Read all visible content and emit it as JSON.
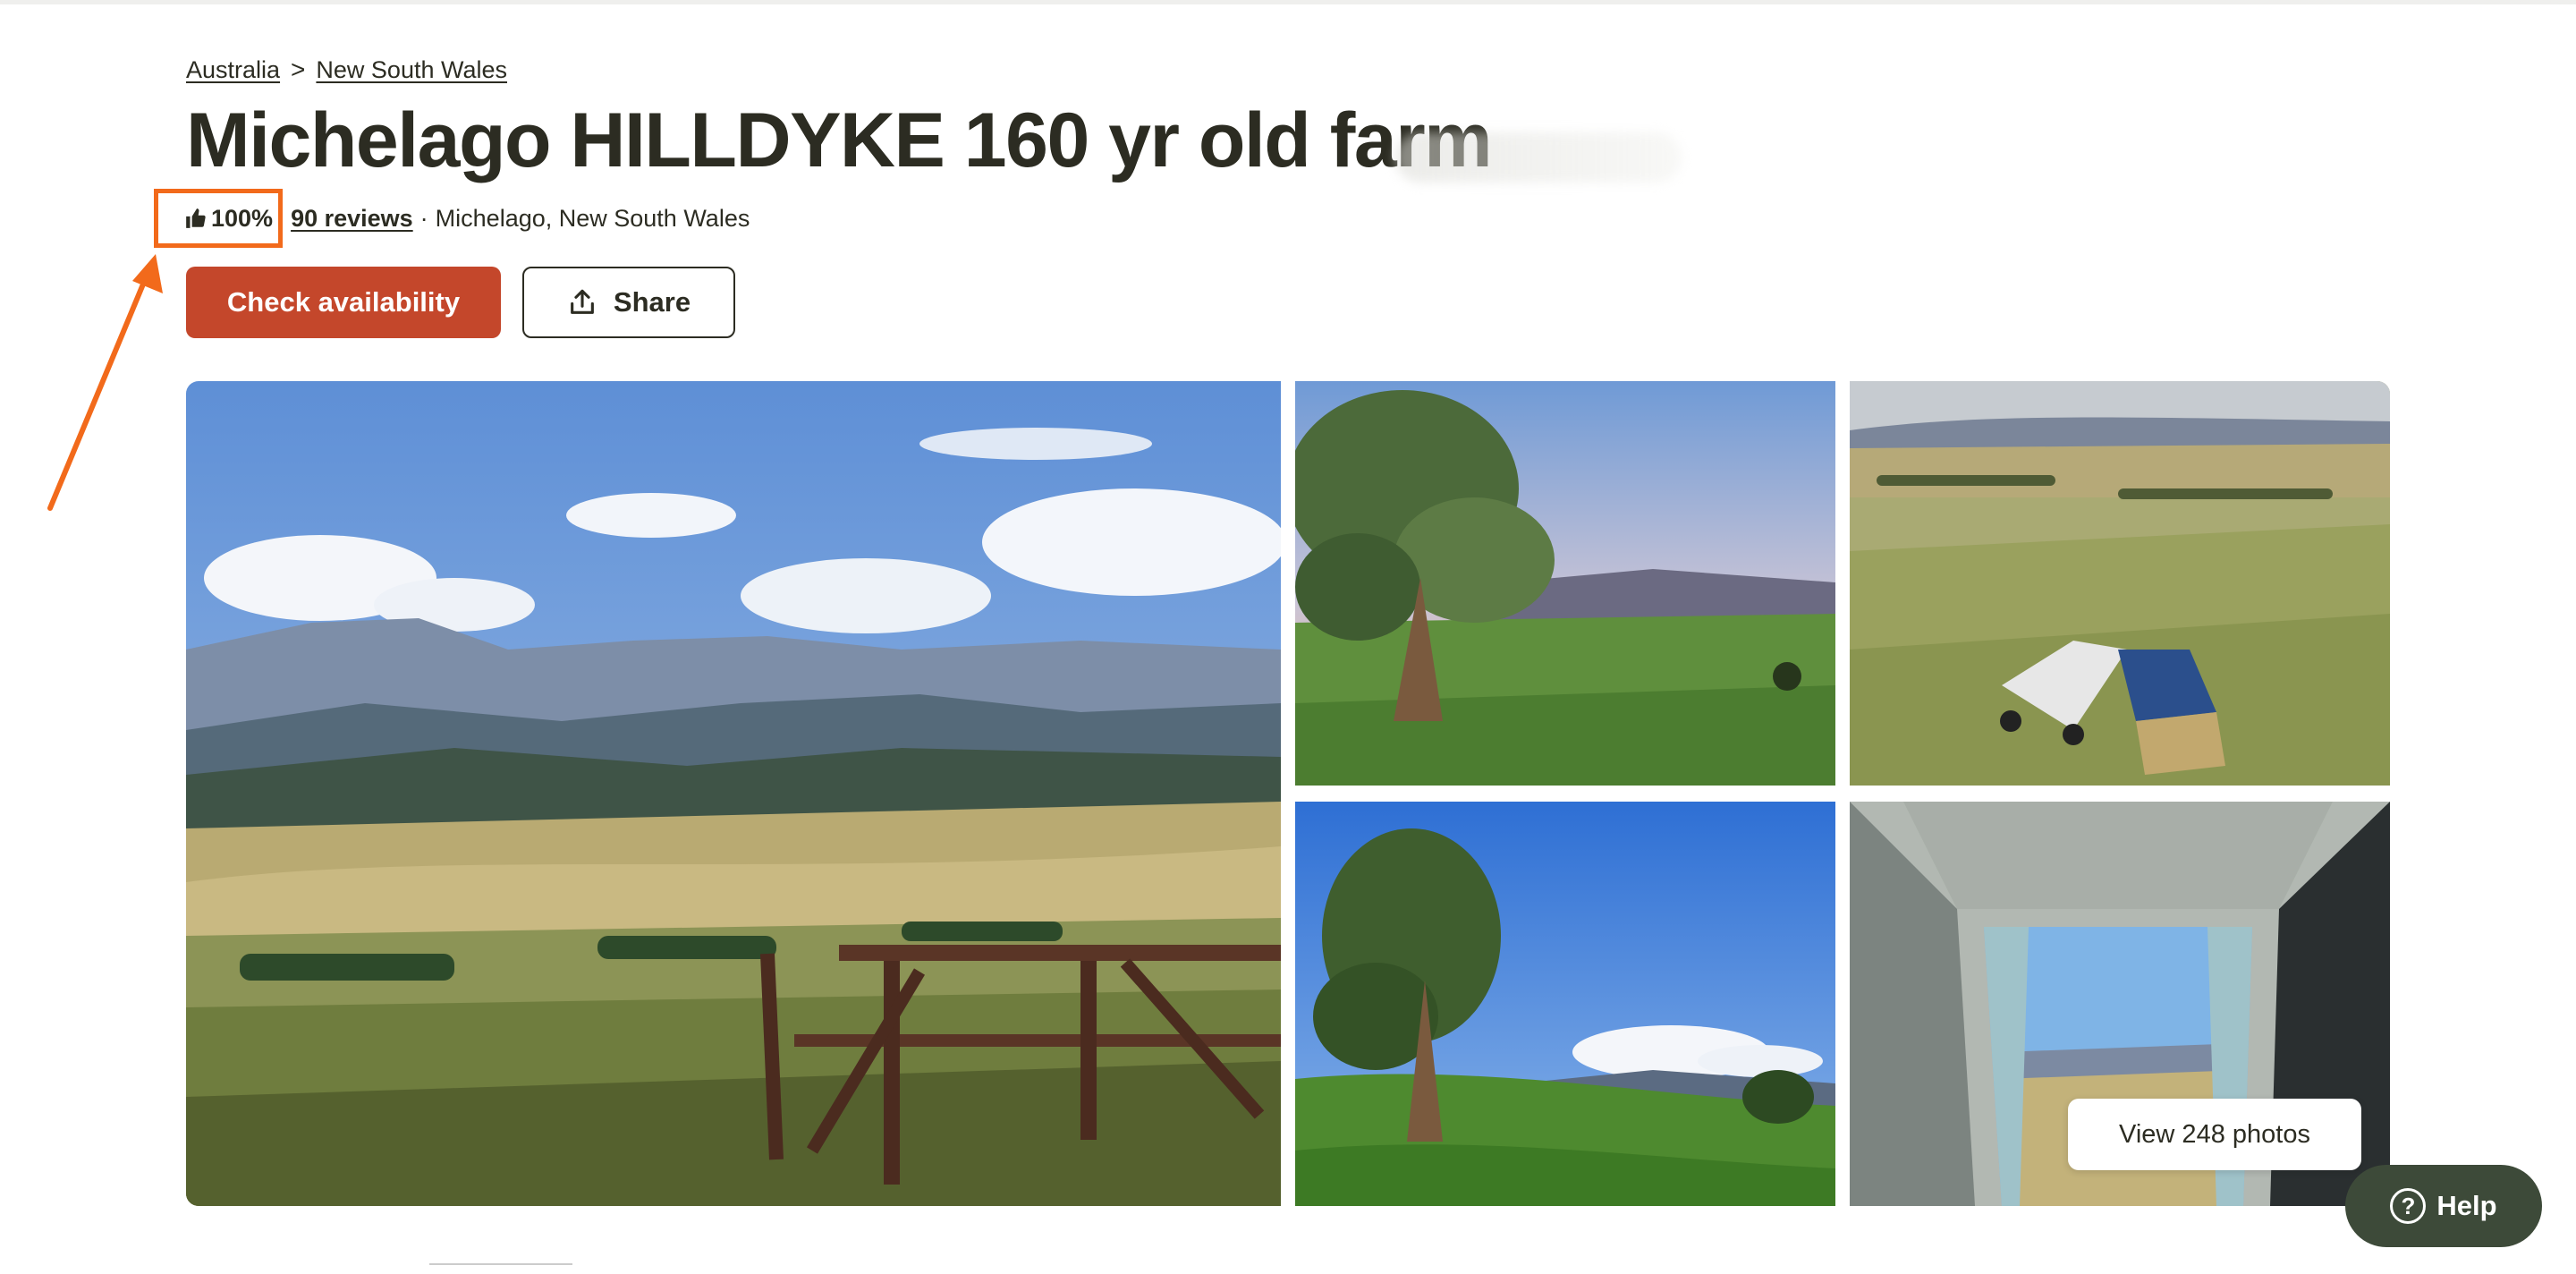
{
  "breadcrumb": {
    "items": [
      "Australia",
      "New South Wales"
    ],
    "separator": ">"
  },
  "listing": {
    "title": "Michelago HILLDYKE 160 yr old farm",
    "rating": "100%",
    "reviews_label": "90 reviews",
    "location_separator": "·",
    "location": "Michelago, New South Wales"
  },
  "actions": {
    "check_availability": "Check availability",
    "share": "Share"
  },
  "gallery": {
    "view_photos": "View 248 photos"
  },
  "help": {
    "label": "Help",
    "icon": "?"
  },
  "colors": {
    "primary": "#c4472b",
    "text": "#2c2c22",
    "annotation": "#f26a1b",
    "help_bg": "#3d4a39"
  },
  "icons": {
    "rating": "thumbs-up-icon",
    "share": "upload-icon",
    "help": "question-circle-icon"
  }
}
